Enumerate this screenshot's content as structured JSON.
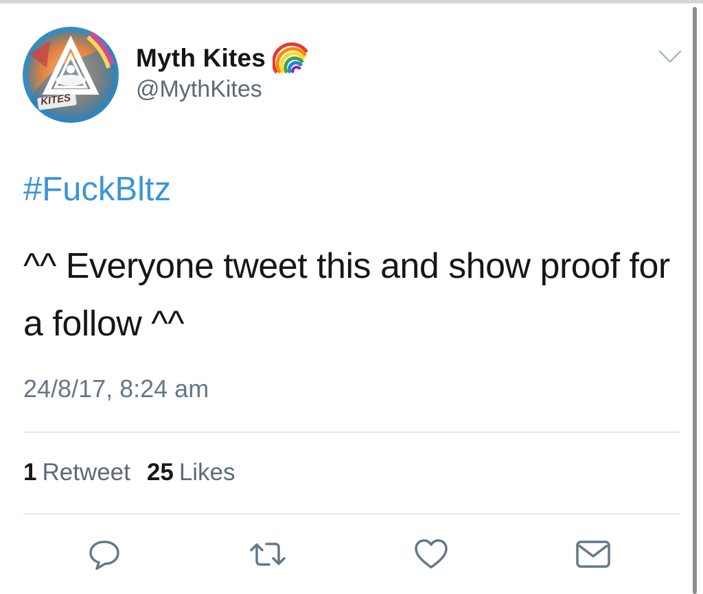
{
  "tweet": {
    "author": {
      "display_name": "Myth Kites",
      "handle": "@MythKites",
      "avatar_text": "KITES",
      "name_emoji_icon": "rainbow-icon"
    },
    "hashtag": "#FuckBltz",
    "text": "^^ Everyone tweet this and show proof for a follow ^^",
    "timestamp": "24/8/17, 8:24 am",
    "stats": {
      "retweets_count": "1",
      "retweets_label": "Retweet",
      "likes_count": "25",
      "likes_label": "Likes"
    },
    "actions": [
      {
        "name": "reply",
        "icon": "reply-icon"
      },
      {
        "name": "retweet",
        "icon": "retweet-icon"
      },
      {
        "name": "like",
        "icon": "heart-icon"
      },
      {
        "name": "direct-message",
        "icon": "envelope-icon"
      }
    ],
    "menu_icon": "chevron-down-icon"
  },
  "colors": {
    "link": "#3b94d9",
    "secondary_text": "#657786",
    "primary_text": "#14171a",
    "icon": "#657786"
  }
}
